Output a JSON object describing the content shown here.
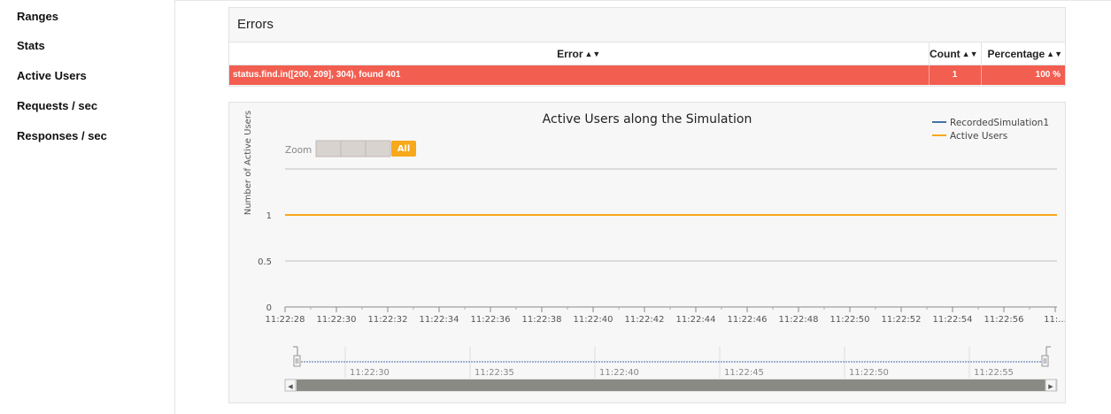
{
  "sidebar": {
    "items": [
      {
        "label": "Ranges"
      },
      {
        "label": "Stats"
      },
      {
        "label": "Active Users"
      },
      {
        "label": "Requests / sec"
      },
      {
        "label": "Responses / sec"
      }
    ]
  },
  "errors": {
    "title": "Errors",
    "columns": [
      "Error",
      "Count",
      "Percentage"
    ],
    "rows": [
      {
        "error": "status.find.in([200, 209], 304), found 401",
        "count": "1",
        "percentage": "100 %"
      }
    ]
  },
  "chart": {
    "zoom_label": "Zoom",
    "zoom_buttons": [
      "",
      "",
      "",
      "All"
    ],
    "zoom_active_index": 3,
    "colors": {
      "recorded": "#4572a7",
      "active": "#f7a81b",
      "zoom_active": "#f7a81b"
    },
    "navigator_ticks": [
      "11:22:30",
      "11:22:35",
      "11:22:40",
      "11:22:45",
      "11:22:50",
      "11:22:55"
    ]
  },
  "chart_data": {
    "type": "line",
    "title": "Active Users along the Simulation",
    "xlabel": "",
    "ylabel": "Number of Active Users",
    "yticks": [
      "0",
      "0.5",
      "1"
    ],
    "ylim": [
      0,
      1.5
    ],
    "xticks": [
      "11:22:28",
      "11:22:30",
      "11:22:32",
      "11:22:34",
      "11:22:36",
      "11:22:38",
      "11:22:40",
      "11:22:42",
      "11:22:44",
      "11:22:46",
      "11:22:48",
      "11:22:50",
      "11:22:52",
      "11:22:54",
      "11:22:56",
      "11:..."
    ],
    "legend": [
      "RecordedSimulation1",
      "Active Users"
    ],
    "legend_position": "top-right",
    "grid": true,
    "series": [
      {
        "name": "Active Users",
        "x": [
          "11:22:28",
          "11:22:58"
        ],
        "values": [
          1,
          1
        ]
      }
    ]
  }
}
